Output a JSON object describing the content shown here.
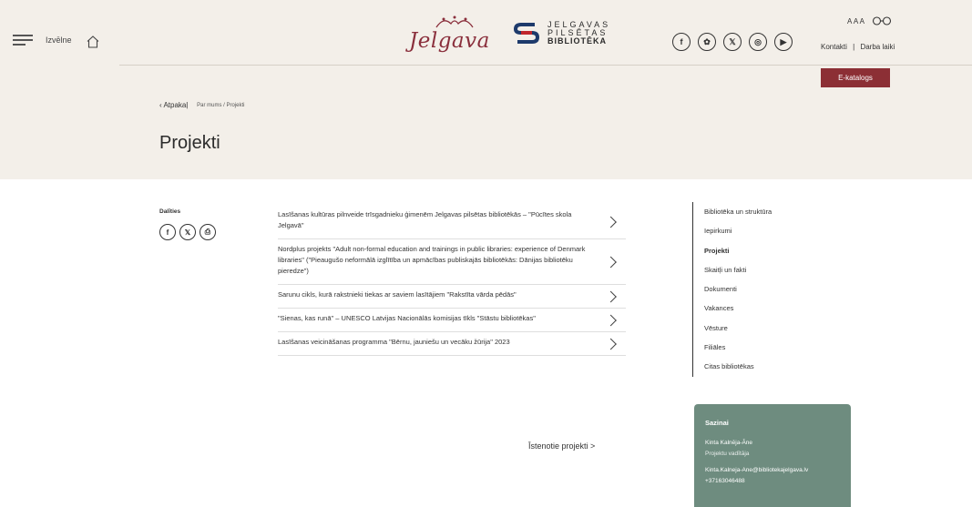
{
  "header": {
    "menu_label": "Izvēlne",
    "logo_jelgava_text": "Jelgava",
    "logo_library_lines": [
      "JELGAVAS",
      "PILSĒTAS",
      "BIBLIOTĒKA"
    ],
    "social_icons": [
      {
        "name": "facebook-icon",
        "glyph": "f"
      },
      {
        "name": "draugiem-icon",
        "glyph": "✿"
      },
      {
        "name": "x-icon",
        "glyph": "𝕏"
      },
      {
        "name": "instagram-icon",
        "glyph": "◎"
      },
      {
        "name": "youtube-icon",
        "glyph": "▶"
      }
    ],
    "font_size_label": "AAA",
    "links": {
      "contacts": "Kontakti",
      "separator": "|",
      "hours": "Darba laiki"
    },
    "ekatalogs_label": "E-katalogs"
  },
  "breadcrumb": {
    "back_label": "‹ Atpakaļ",
    "path": "Par mums / Projekti"
  },
  "page_title": "Projekti",
  "share": {
    "label": "Dalīties",
    "icons": [
      {
        "name": "facebook-icon",
        "glyph": "f"
      },
      {
        "name": "x-icon",
        "glyph": "𝕏"
      },
      {
        "name": "print-icon",
        "glyph": "⎙"
      }
    ]
  },
  "projects": [
    "Lasīšanas kultūras pilnveide trīsgadnieku ģimenēm Jelgavas pilsētas bibliotēkās – \"Pūcītes skola Jelgavā\"",
    "Nordplus projekts \"Adult non-formal education and trainings in public libraries: experience of Denmark libraries\" (\"Pieaugušo neformālā izglītība un apmācības publiskajās bibliotēkās: Dānijas bibliotēku pieredze\")",
    "Sarunu cikls, kurā rakstnieki tiekas ar saviem lasītājiem \"Rakstīta vārda pēdās\"",
    "\"Sienas, kas runā\" – UNESCO Latvijas Nacionālās komisijas tīkls \"Stāstu bibliotēkas\"",
    "Lasīšanas veicināšanas programma \"Bērnu, jauniešu un vecāku žūrija\" 2023"
  ],
  "completed_link": "Īstenotie projekti >",
  "sidenav": [
    {
      "label": "Bibliotēka un struktūra",
      "active": false
    },
    {
      "label": "Iepirkumi",
      "active": false
    },
    {
      "label": "Projekti",
      "active": true
    },
    {
      "label": "Skaitļi un fakti",
      "active": false
    },
    {
      "label": "Dokumenti",
      "active": false
    },
    {
      "label": "Vakances",
      "active": false
    },
    {
      "label": "Vēsture",
      "active": false
    },
    {
      "label": "Filiāles",
      "active": false
    },
    {
      "label": "Citas bibliotēkas",
      "active": false
    }
  ],
  "contact": {
    "title": "Sazinai",
    "name": "Kinta Kalnēja-Āne",
    "role": "Projektu vadītāja",
    "email": "Kinta.Kalneja-Ane@bibliotekajelgava.lv",
    "phone": "+37163046488"
  },
  "colors": {
    "hero_bg": "#f3efe9",
    "accent": "#8c2f35",
    "contact_bg": "#6e8c7f"
  }
}
